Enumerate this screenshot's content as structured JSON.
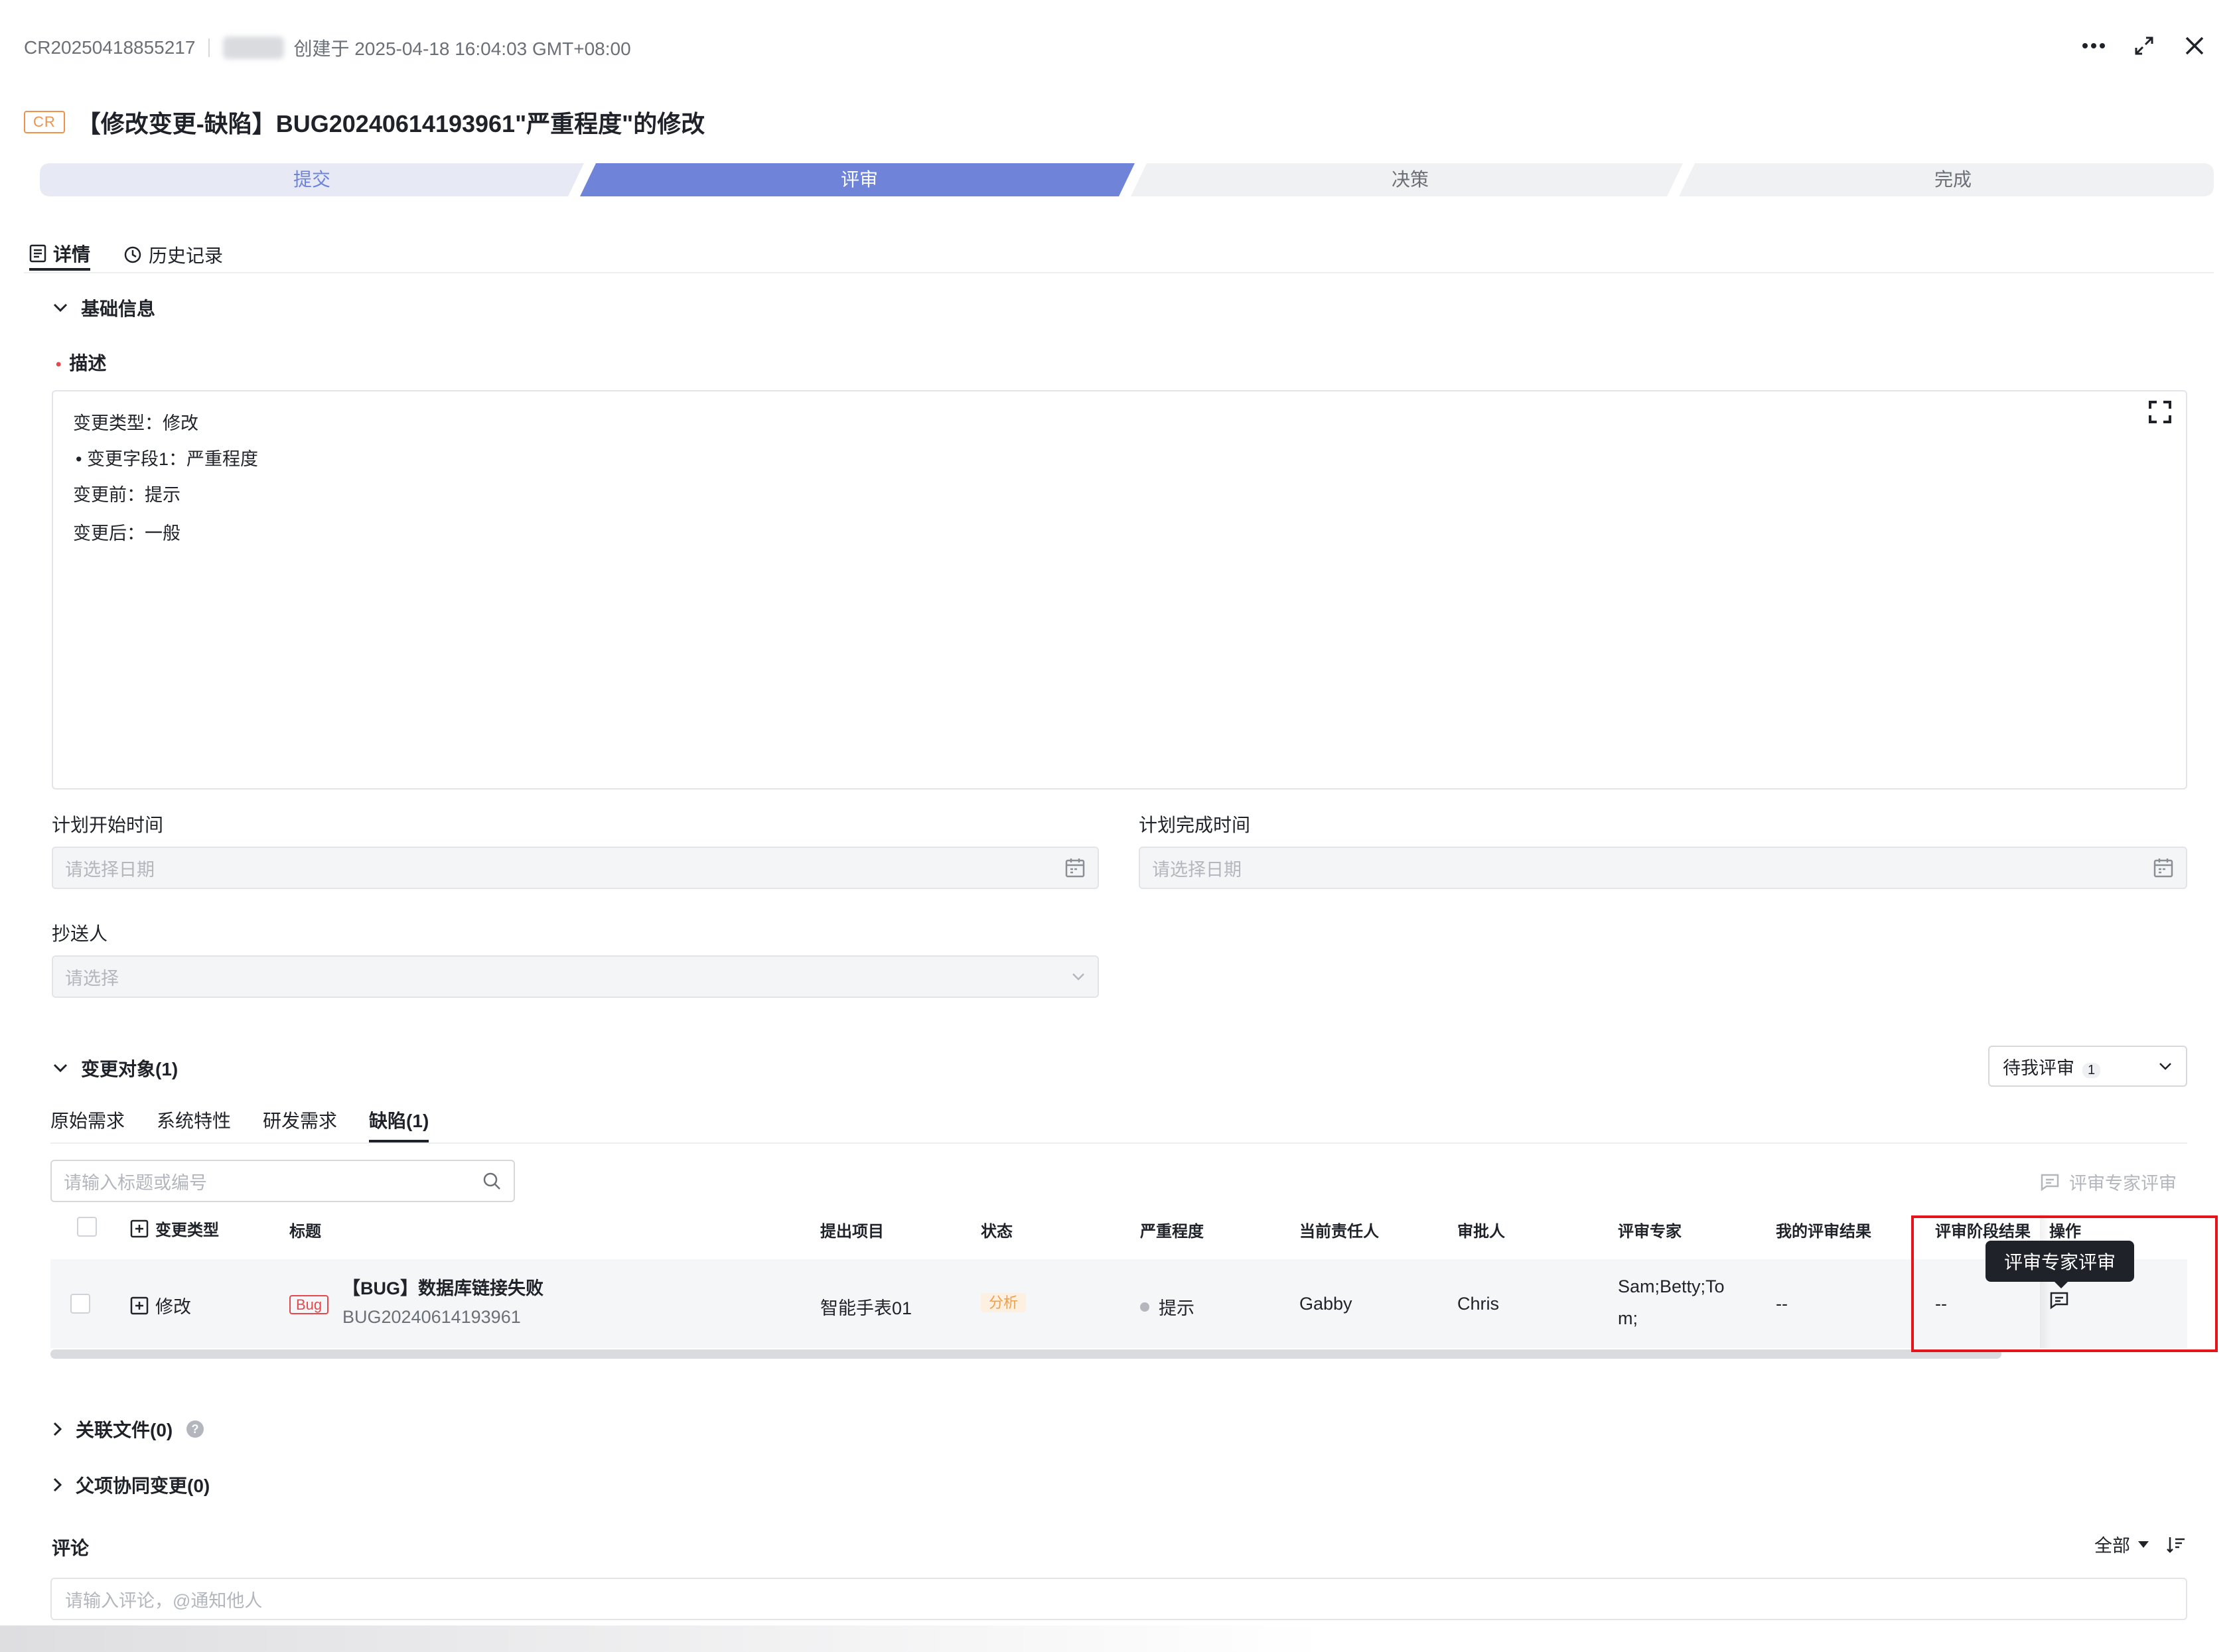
{
  "header": {
    "cr_id": "CR20250418855217",
    "created_text": "创建于 2025-04-18 16:04:03 GMT+08:00",
    "badge": "CR",
    "title": "【修改变更-缺陷】BUG20240614193961\"严重程度\"的修改"
  },
  "stepper": {
    "steps": [
      "提交",
      "评审",
      "决策",
      "完成"
    ],
    "active_index": 1
  },
  "tabs": [
    "详情",
    "历史记录"
  ],
  "basic": {
    "section_title": "基础信息",
    "desc_label": "描述",
    "desc_lines": [
      "变更类型：修改",
      "•  变更字段1：严重程度",
      "变更前：提示",
      "变更后：一般"
    ],
    "start_label": "计划开始时间",
    "start_placeholder": "请选择日期",
    "end_label": "计划完成时间",
    "end_placeholder": "请选择日期",
    "cc_label": "抄送人",
    "cc_placeholder": "请选择"
  },
  "change_objects": {
    "section_title": "变更对象(1)",
    "filter_label": "待我评审",
    "filter_count": "1",
    "subtabs": [
      "原始需求",
      "系统特性",
      "研发需求",
      "缺陷(1)"
    ],
    "active_subtab": 3,
    "search_placeholder": "请输入标题或编号",
    "expert_review_button": "评审专家评审",
    "columns": [
      "变更类型",
      "标题",
      "提出项目",
      "状态",
      "严重程度",
      "当前责任人",
      "审批人",
      "评审专家",
      "我的评审结果",
      "评审阶段结果",
      "操作"
    ],
    "rows": [
      {
        "change_type": "修改",
        "type_badge": "Bug",
        "title": "【BUG】数据库链接失败",
        "code": "BUG20240614193961",
        "project": "智能手表01",
        "status": "分析",
        "severity": "提示",
        "owner": "Gabby",
        "approver": "Chris",
        "experts_line1": "Sam;Betty;To",
        "experts_line2": "m;",
        "my_result": "--",
        "stage_result": "--"
      }
    ],
    "tooltip": "评审专家评审"
  },
  "related_files": "关联文件(0)",
  "parent_changes": "父项协同变更(0)",
  "comments": {
    "label": "评论",
    "filter": "全部",
    "placeholder": "请输入评论，@通知他人"
  },
  "colors": {
    "accent": "#6f84d9",
    "step_inactive": "#e7eaf5",
    "step_future": "#f0f1f3",
    "red": "#e5141b",
    "orange": "#f0924a"
  }
}
